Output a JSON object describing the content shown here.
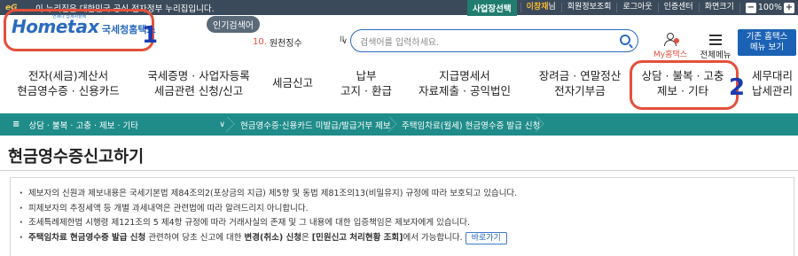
{
  "gov_bar": {
    "logo": "eG",
    "text": "이 누리집은 대한민국 공식 전자정부 누리집입니다.",
    "business_select": "사업장선택",
    "user_name": "이창재",
    "user_suffix": "님",
    "links": [
      "회원정보조회",
      "로그아웃",
      "인증센터",
      "화면크기"
    ],
    "zoom_minus": "−",
    "zoom_level": "100%",
    "zoom_plus": "+"
  },
  "header": {
    "logo_home": "Home",
    "logo_tax": "tax",
    "logo_sub": "국세청홈택스",
    "logo_small": "언제나 납세자곁에",
    "annotation_1": "1",
    "popular_label": "인기검색어",
    "popular_num": "10.",
    "popular_term": "원천징수",
    "popular_arrow": "∨",
    "popular_pause": "II",
    "search_placeholder": "검색어를 입력하세요.",
    "my_home": "My홈택스",
    "all_menu": "전체메뉴",
    "home_btn_line1": "기존 홈택스",
    "home_btn_line2": "메뉴 보기"
  },
  "nav": {
    "items": [
      {
        "line1": "전자(세금)계산서",
        "line2": "현금영수증 · 신용카드"
      },
      {
        "line1": "국세증명 · 사업자등록",
        "line2": "세금관련 신청/신고"
      },
      {
        "line1": "세금신고",
        "line2": ""
      },
      {
        "line1": "납부",
        "line2": "고지 · 환급"
      },
      {
        "line1": "지급명세서",
        "line2": "자료제출 · 공익법인"
      },
      {
        "line1": "장려금 · 연말정산",
        "line2": "전자기부금"
      },
      {
        "line1": "상담 · 불복 · 고충",
        "line2": "제보 · 기타"
      },
      {
        "line1": "세무대리",
        "line2": "납세관리"
      }
    ],
    "annotation_2": "2"
  },
  "breadcrumb": {
    "menu": "상담 · 불복 · 고충 · 제보 · 기타",
    "level2": "현금영수증·신용카드 미발급/발급거부 제보",
    "level3": "주택임차료(월세) 현금영수증 발급 신청"
  },
  "main": {
    "title": "현금영수증신고하기",
    "notices": [
      "제보자의 신원과 제보내용은 국세기본법 제84조의2(포상금의 지급) 제5항 및 동법 제81조의13(비밀유지) 규정에 따라 보호되고 있습니다.",
      "피제보자의 추징세액 등 개별 과세내역은 관련법에 따라 알려드리지 아니합니다.",
      "조세특례제한법 시행령 제121조의 5 제4항 규정에 따라 거래사실의 존재 및 그 내용에 대한 입증책임은 제보자에게 있습니다."
    ],
    "last_notice_bold1": "주택임차료 현금영수증 발급 신청",
    "last_notice_mid1": " 관련하여 당초 신고에 대한 ",
    "last_notice_bold2": "변경(취소) 신청",
    "last_notice_mid2": "은 ",
    "last_notice_bold3": "[민원신고 처리현황 조회]",
    "last_notice_end": "에서 가능합니다.",
    "goto_button": "바로가기"
  }
}
